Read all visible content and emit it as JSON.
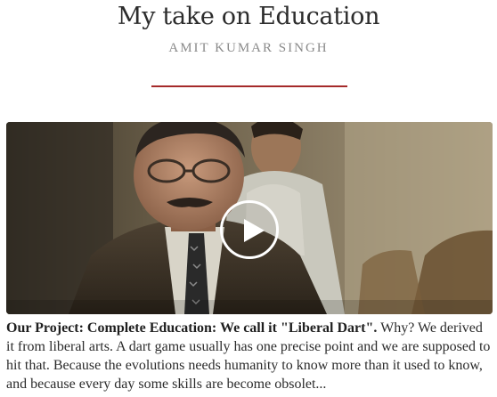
{
  "post": {
    "title": "My take on Education",
    "author": "AMIT KUMAR SINGH",
    "accent_color": "#a52a2a"
  },
  "video": {
    "play_icon": "play-icon"
  },
  "excerpt": {
    "lead": "Our Project: Complete Education: We call it \"Liberal Dart\".",
    "body": " Why? We derived it from liberal arts. A dart game usually has one precise point and we are supposed to hit that. Because the evolutions needs humanity to know more than it used to know, and because every day some skills are become obsolet..."
  }
}
